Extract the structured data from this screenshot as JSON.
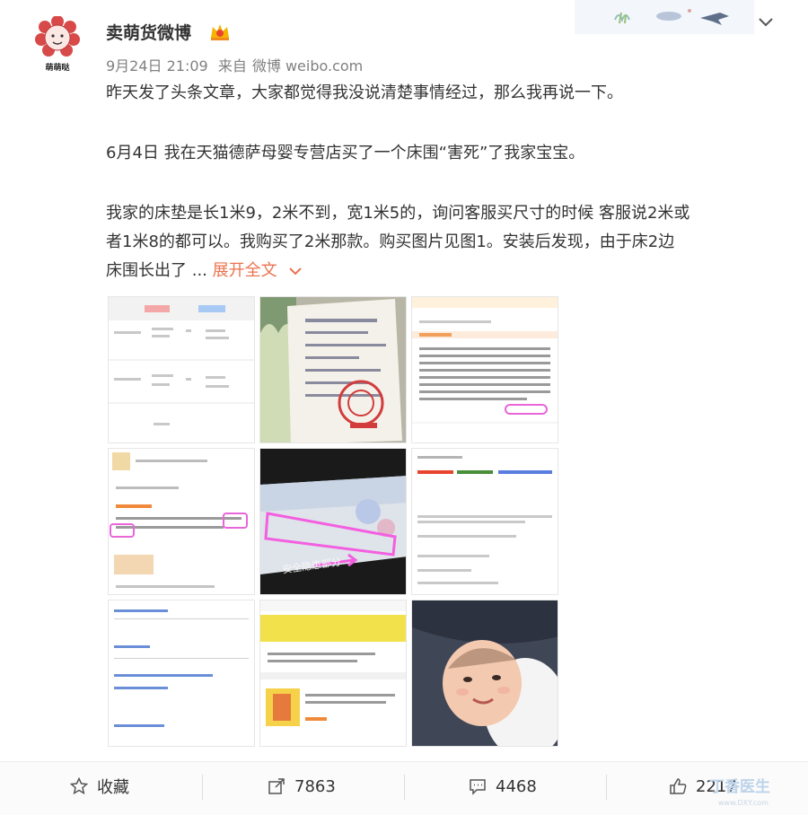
{
  "user": {
    "name": "卖萌货微博",
    "avatar_caption": "萌萌哒"
  },
  "post": {
    "date": "9月24日 21:09",
    "via_label": "来自",
    "source": "微博 weibo.com",
    "lines": [
      "昨天发了头条文章，大家都觉得我没说清楚事情经过，那么我再说一下。",
      "6月4日 我在天猫德萨母婴专营店买了一个床围“害死”了我家宝宝。",
      "我家的床垫是长1米9，2米不到，宽1米5的，询问客服买尺寸的时候 客服说2米或",
      "者1米8的都可以。我购买了2米那款。购买图片见图1。安装后发现，由于床2边",
      "床围长出了 ..."
    ],
    "expand_label": "展开全文"
  },
  "images": [
    {
      "name": "order-screenshot"
    },
    {
      "name": "receipt-photo"
    },
    {
      "name": "chat-screenshot"
    },
    {
      "name": "review-screenshot"
    },
    {
      "name": "bumper-photo",
      "caption": "安全隐患部分"
    },
    {
      "name": "document-screenshot"
    },
    {
      "name": "complaint-screenshot"
    },
    {
      "name": "shop-screenshot"
    },
    {
      "name": "baby-photo"
    }
  ],
  "actions": {
    "favorite_label": "收藏",
    "share_count": "7863",
    "comment_count": "4468",
    "like_count": "2217"
  },
  "watermark": {
    "text": "丁香医生",
    "url": "www.DXY.com"
  },
  "colors": {
    "link": "#eb7350",
    "meta": "#808080",
    "text": "#333333"
  }
}
